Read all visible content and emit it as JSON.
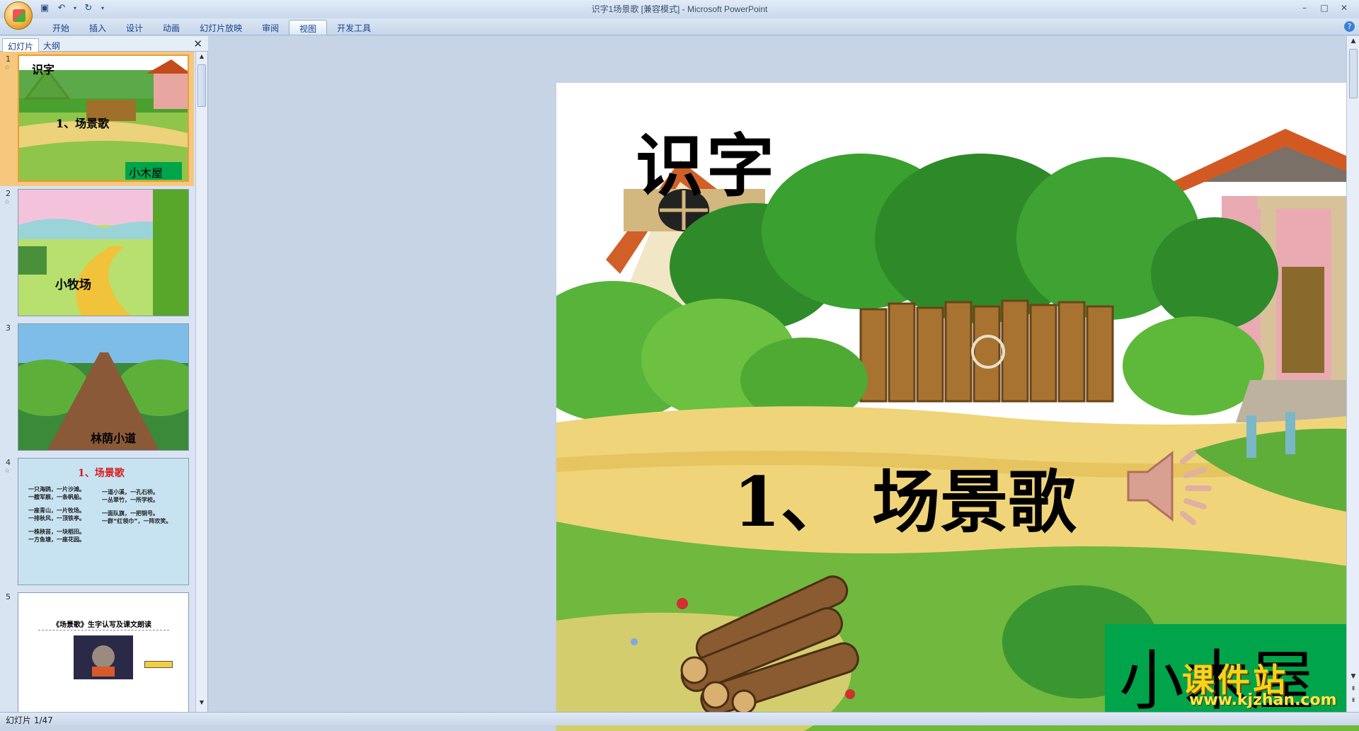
{
  "window": {
    "title": "识字1场景歌 [兼容模式] - Microsoft PowerPoint",
    "minimize": "–",
    "maximize": "□",
    "close": "✕"
  },
  "ribbon": {
    "tabs": [
      "开始",
      "插入",
      "设计",
      "动画",
      "幻灯片放映",
      "审阅",
      "视图",
      "开发工具"
    ],
    "active_tab": "视图",
    "help": "?"
  },
  "panel": {
    "tab_slides": "幻灯片",
    "tab_outline": "大纲",
    "close": "✕"
  },
  "thumbnails": [
    {
      "num": "1",
      "title": "识字",
      "subtitle": "1、场景歌",
      "box": "小木屋"
    },
    {
      "num": "2",
      "label": "小牧场"
    },
    {
      "num": "3",
      "label": "林荫小道"
    },
    {
      "num": "4",
      "title": "1、场景歌",
      "lines_left": [
        "一只海鸥，一片沙滩。",
        "一艘军舰，一条帆船。",
        "一座青山，一片牧场。",
        "一排秋风，一顶铁亭。",
        "一株秧苗，一块稻田。",
        "一方鱼塘，一座花园。"
      ],
      "lines_right": [
        "一道小溪，一孔石桥。",
        "一丛翠竹，一所学校。",
        "一面队旗，一把铜号。",
        "一群“红领巾”，一阵欢笑。"
      ]
    },
    {
      "num": "5",
      "title": "《场景歌》生字认写及课文朗读"
    }
  ],
  "slide": {
    "title": "识字",
    "subtitle": "1、  场景歌",
    "box_label": "小木屋",
    "box_color": "#00a44a"
  },
  "status": {
    "slide_counter": "幻灯片 1/47"
  },
  "watermark": {
    "name": "课件站",
    "url": "www.kjzhan.com"
  }
}
